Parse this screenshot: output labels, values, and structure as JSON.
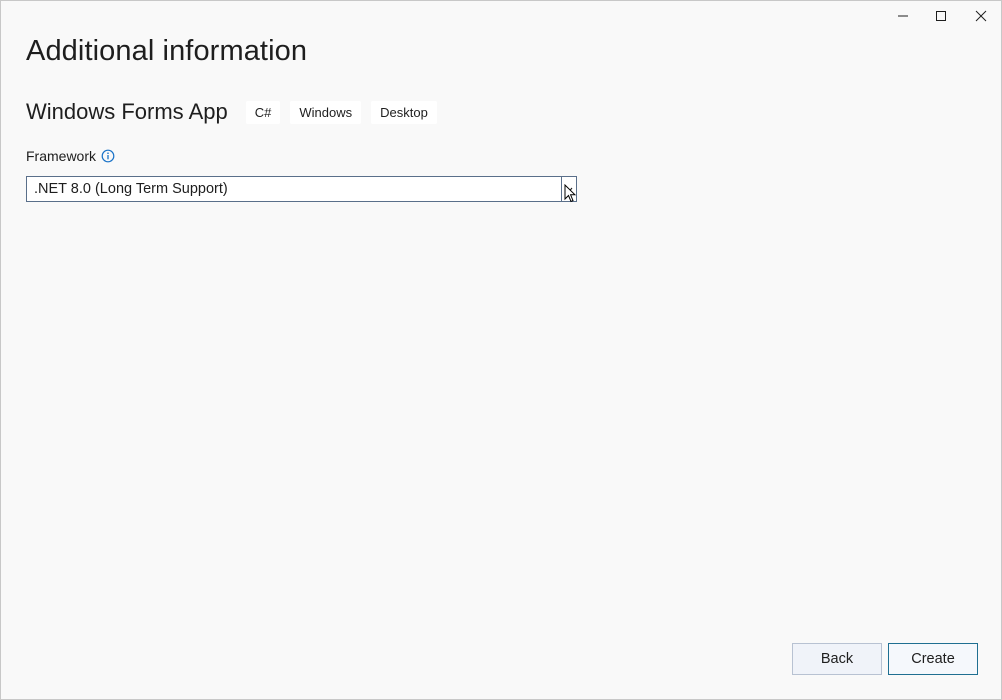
{
  "window": {
    "controls": {
      "minimize_icon": "minimize-icon",
      "maximize_icon": "maximize-icon",
      "close_icon": "close-icon"
    }
  },
  "header": {
    "title": "Additional information"
  },
  "project": {
    "name": "Windows Forms App",
    "tags": [
      "C#",
      "Windows",
      "Desktop"
    ]
  },
  "framework": {
    "label": "Framework",
    "info_icon": "info-icon",
    "selected": ".NET 8.0 (Long Term Support)"
  },
  "footer": {
    "back_label": "Back",
    "create_label": "Create"
  },
  "colors": {
    "background": "#f9f9f9",
    "accent": "#1f6f91",
    "info": "#1a73c8"
  }
}
